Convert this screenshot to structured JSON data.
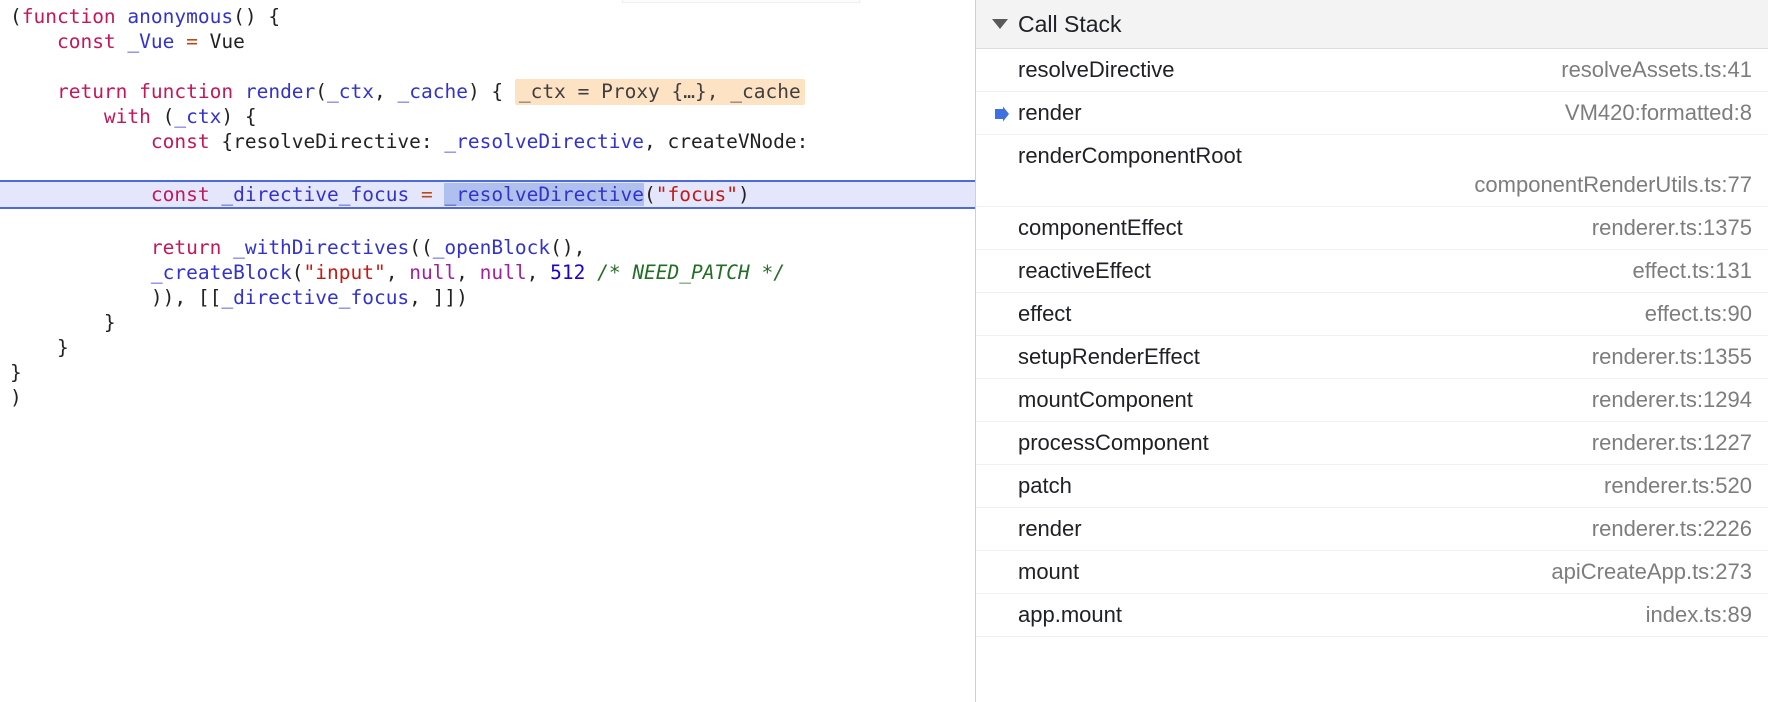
{
  "editor": {
    "name": "code-viewer",
    "lines": [
      {
        "id": "l1",
        "tokens": [
          {
            "t": "(",
            "c": "plain"
          },
          {
            "t": "function",
            "c": "keyword"
          },
          {
            "t": " ",
            "c": "plain"
          },
          {
            "t": "anonymous",
            "c": "var"
          },
          {
            "t": "() {",
            "c": "plain"
          }
        ]
      },
      {
        "id": "l2",
        "tokens": [
          {
            "t": "    ",
            "c": "plain"
          },
          {
            "t": "const",
            "c": "keyword"
          },
          {
            "t": " ",
            "c": "plain"
          },
          {
            "t": "_Vue",
            "c": "var"
          },
          {
            "t": " ",
            "c": "plain"
          },
          {
            "t": "=",
            "c": "op"
          },
          {
            "t": " Vue",
            "c": "plain"
          }
        ]
      },
      {
        "id": "l3",
        "tokens": []
      },
      {
        "id": "l4",
        "tokens": [
          {
            "t": "    ",
            "c": "plain"
          },
          {
            "t": "return",
            "c": "keyword"
          },
          {
            "t": " ",
            "c": "plain"
          },
          {
            "t": "function",
            "c": "keyword"
          },
          {
            "t": " ",
            "c": "plain"
          },
          {
            "t": "render",
            "c": "var"
          },
          {
            "t": "(",
            "c": "plain"
          },
          {
            "t": "_ctx",
            "c": "var"
          },
          {
            "t": ", ",
            "c": "plain"
          },
          {
            "t": "_cache",
            "c": "var"
          },
          {
            "t": ") { ",
            "c": "plain"
          },
          {
            "t": "_ctx = Proxy {…}, _cache",
            "c": "inline-eval"
          }
        ]
      },
      {
        "id": "l5",
        "tokens": [
          {
            "t": "        ",
            "c": "plain"
          },
          {
            "t": "with",
            "c": "keyword"
          },
          {
            "t": " (",
            "c": "plain"
          },
          {
            "t": "_ctx",
            "c": "var"
          },
          {
            "t": ") {",
            "c": "plain"
          }
        ]
      },
      {
        "id": "l6",
        "tokens": [
          {
            "t": "            ",
            "c": "plain"
          },
          {
            "t": "const",
            "c": "keyword"
          },
          {
            "t": " {resolveDirective: ",
            "c": "plain"
          },
          {
            "t": "_resolveDirective",
            "c": "var"
          },
          {
            "t": ", createVNode:",
            "c": "plain"
          }
        ]
      },
      {
        "id": "l7",
        "tokens": []
      },
      {
        "id": "l8",
        "exec": true,
        "tokens": [
          {
            "t": "            ",
            "c": "plain"
          },
          {
            "t": "const",
            "c": "keyword"
          },
          {
            "t": " ",
            "c": "plain"
          },
          {
            "t": "_directive_focus",
            "c": "var"
          },
          {
            "t": " ",
            "c": "plain"
          },
          {
            "t": "=",
            "c": "op"
          },
          {
            "t": " ",
            "c": "plain"
          },
          {
            "t": "_resolveDirective",
            "c": "selected"
          },
          {
            "t": "(",
            "c": "plain"
          },
          {
            "t": "\"focus\"",
            "c": "str"
          },
          {
            "t": ")",
            "c": "plain"
          }
        ]
      },
      {
        "id": "l9",
        "tokens": []
      },
      {
        "id": "l10",
        "tokens": [
          {
            "t": "            ",
            "c": "plain"
          },
          {
            "t": "return",
            "c": "keyword"
          },
          {
            "t": " ",
            "c": "plain"
          },
          {
            "t": "_withDirectives",
            "c": "var"
          },
          {
            "t": "((",
            "c": "plain"
          },
          {
            "t": "_openBlock",
            "c": "var"
          },
          {
            "t": "(),",
            "c": "plain"
          }
        ]
      },
      {
        "id": "l11",
        "tokens": [
          {
            "t": "            ",
            "c": "plain"
          },
          {
            "t": "_createBlock",
            "c": "var"
          },
          {
            "t": "(",
            "c": "plain"
          },
          {
            "t": "\"input\"",
            "c": "str"
          },
          {
            "t": ", ",
            "c": "plain"
          },
          {
            "t": "null",
            "c": "null"
          },
          {
            "t": ", ",
            "c": "plain"
          },
          {
            "t": "null",
            "c": "null"
          },
          {
            "t": ", ",
            "c": "plain"
          },
          {
            "t": "512",
            "c": "num"
          },
          {
            "t": " ",
            "c": "plain"
          },
          {
            "t": "/* NEED_PATCH */",
            "c": "comment"
          }
        ]
      },
      {
        "id": "l12",
        "tokens": [
          {
            "t": "            )), [[",
            "c": "plain"
          },
          {
            "t": "_directive_focus",
            "c": "var"
          },
          {
            "t": ", ]])",
            "c": "plain"
          }
        ]
      },
      {
        "id": "l13",
        "tokens": [
          {
            "t": "        }",
            "c": "plain"
          }
        ]
      },
      {
        "id": "l14",
        "tokens": [
          {
            "t": "    }",
            "c": "plain"
          }
        ]
      },
      {
        "id": "l15",
        "tokens": [
          {
            "t": "}",
            "c": "plain"
          }
        ]
      },
      {
        "id": "l16",
        "tokens": [
          {
            "t": ")",
            "c": "plain"
          }
        ]
      }
    ]
  },
  "call_stack": {
    "title": "Call Stack",
    "disclosure_icon": "triangle-down-icon",
    "active_frame_icon": "arrow-right-marker-icon",
    "frames": [
      {
        "name": "resolveDirective",
        "location": "resolveAssets.ts:41",
        "active": false,
        "wrap": false
      },
      {
        "name": "render",
        "location": "VM420:formatted:8",
        "active": true,
        "wrap": false
      },
      {
        "name": "renderComponentRoot",
        "location": "componentRenderUtils.ts:77",
        "active": false,
        "wrap": true
      },
      {
        "name": "componentEffect",
        "location": "renderer.ts:1375",
        "active": false,
        "wrap": false
      },
      {
        "name": "reactiveEffect",
        "location": "effect.ts:131",
        "active": false,
        "wrap": false
      },
      {
        "name": "effect",
        "location": "effect.ts:90",
        "active": false,
        "wrap": false
      },
      {
        "name": "setupRenderEffect",
        "location": "renderer.ts:1355",
        "active": false,
        "wrap": false
      },
      {
        "name": "mountComponent",
        "location": "renderer.ts:1294",
        "active": false,
        "wrap": false
      },
      {
        "name": "processComponent",
        "location": "renderer.ts:1227",
        "active": false,
        "wrap": false
      },
      {
        "name": "patch",
        "location": "renderer.ts:520",
        "active": false,
        "wrap": false
      },
      {
        "name": "render",
        "location": "renderer.ts:2226",
        "active": false,
        "wrap": false
      },
      {
        "name": "mount",
        "location": "apiCreateApp.ts:273",
        "active": false,
        "wrap": false
      },
      {
        "name": "app.mount",
        "location": "index.ts:89",
        "active": false,
        "wrap": false
      }
    ]
  },
  "colors": {
    "exec_line_bg": "#e4e7fb",
    "exec_line_border": "#4f6bd8",
    "selection_bg": "#b0c0ee",
    "inline_eval_bg": "#fde2c4",
    "keyword": "#c2185b",
    "identifier": "#3333cc",
    "string": "#c41a16",
    "number": "#1c00cf",
    "null_literal": "#a020a0",
    "comment": "#236e25",
    "operator": "#b84a1e",
    "sidebar_header_bg": "#f3f3f3",
    "location_text": "#7d7d7d",
    "active_marker": "#3f6fe0"
  }
}
